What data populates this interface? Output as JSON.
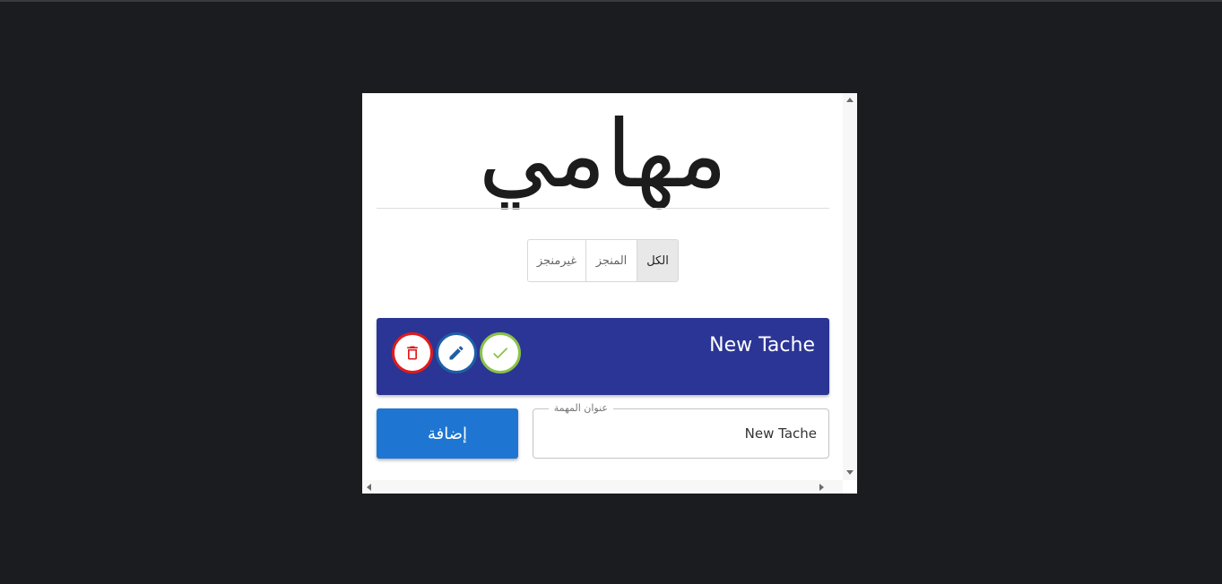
{
  "app": {
    "title": "مهامي"
  },
  "filters": [
    {
      "label": "غيرمنجز"
    },
    {
      "label": "المنجز"
    },
    {
      "label": "الكل",
      "selected": true
    }
  ],
  "tasks": [
    {
      "title": "New Tache",
      "done": false
    }
  ],
  "form": {
    "field_label": "عنوان المهمة",
    "field_value": "New Tache",
    "add_label": "إضافة"
  },
  "colors": {
    "background": "#1b1c1f",
    "card": "#ffffff",
    "task_bg": "#2b3595",
    "add_button": "#1e76d2",
    "delete": "#e01b1b",
    "edit": "#1e5fa6",
    "done": "#8ac24a"
  },
  "icons": {
    "delete": "trash-icon",
    "edit": "pencil-icon",
    "done": "check-icon"
  }
}
